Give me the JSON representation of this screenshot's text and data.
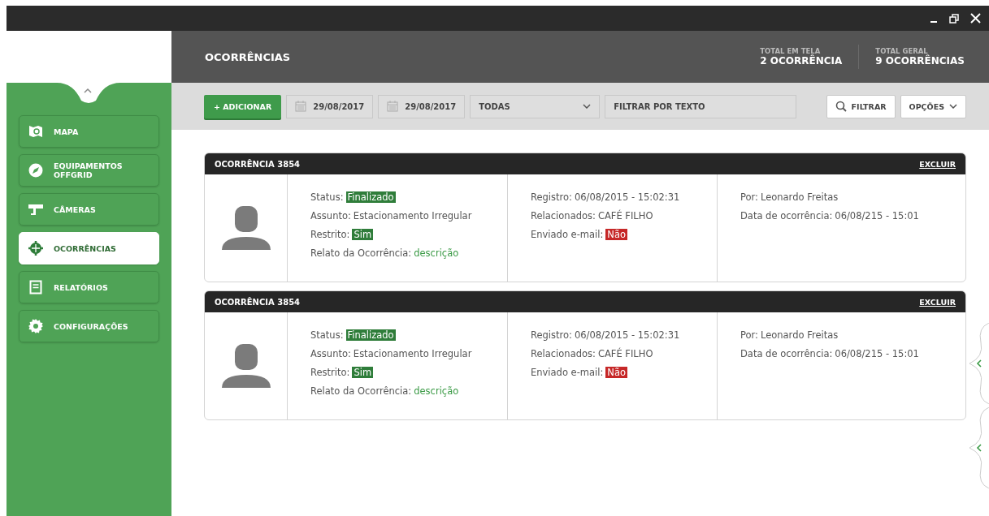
{
  "sidebar": {
    "items": [
      {
        "label": "MAPA",
        "selected": false
      },
      {
        "label": "EQUIPAMENTOS OFFGRID",
        "selected": false
      },
      {
        "label": "CÂMERAS",
        "selected": false
      },
      {
        "label": "OCORRÊNCIAS",
        "selected": true
      },
      {
        "label": "RELATÓRIOS",
        "selected": false
      },
      {
        "label": "CONFIGURAÇÕES",
        "selected": false
      }
    ]
  },
  "header": {
    "title": "OCORRÊNCIAS",
    "totals": [
      {
        "label": "TOTAL EM TELA",
        "value": "2 OCORRÊNCIA"
      },
      {
        "label": "TOTAL GERAL",
        "value": "9 OCORRÊNCIAS"
      }
    ]
  },
  "toolbar": {
    "add_button": "+ ADICIONAR",
    "dates": [
      "29/08/2017",
      "29/08/2017"
    ],
    "select": "TODAS",
    "search": {
      "placeholder": "FILTRAR POR TEXTO"
    },
    "filter_button": "FILTRAR",
    "options_button": "OPÇÕES"
  },
  "cards": [
    {
      "title": "OCORRÊNCIA 3854",
      "delete": "EXCLUIR",
      "columns": [
        [
          {
            "label": "Status:",
            "value": "Finalizado",
            "kind": "badge",
            "color": "#2f7d3a"
          },
          {
            "label": "Assunto:",
            "value": "Estacionamento Irregular",
            "kind": "plain"
          },
          {
            "label": "Restrito:",
            "value": "Sim",
            "kind": "badge",
            "color": "#2f7d3a"
          },
          {
            "label": "Relato da Ocorrência:",
            "value": "descrição",
            "kind": "link"
          }
        ],
        [
          {
            "label": "Registro:",
            "value": "06/08/2015 - 15:02:31",
            "kind": "plain"
          },
          {
            "label": "Relacionados:",
            "value": "CAFÉ FILHO",
            "kind": "plain"
          },
          {
            "label": "Enviado e-mail:",
            "value": "Não",
            "kind": "badge",
            "color": "#c62828"
          }
        ],
        [
          {
            "label": "Por:",
            "value": "Leonardo Freitas",
            "kind": "plain"
          },
          {
            "label": "Data de ocorrência:",
            "value": "06/08/215 - 15:01",
            "kind": "plain"
          }
        ]
      ]
    },
    {
      "title": "OCORRÊNCIA 3854",
      "delete": "EXCLUIR",
      "columns": [
        [
          {
            "label": "Status:",
            "value": "Finalizado",
            "kind": "badge",
            "color": "#2f7d3a"
          },
          {
            "label": "Assunto:",
            "value": "Estacionamento Irregular",
            "kind": "plain"
          },
          {
            "label": "Restrito:",
            "value": "Sim",
            "kind": "badge",
            "color": "#2f7d3a"
          },
          {
            "label": "Relato da Ocorrência:",
            "value": "descrição",
            "kind": "link"
          }
        ],
        [
          {
            "label": "Registro:",
            "value": "06/08/2015 - 15:02:31",
            "kind": "plain"
          },
          {
            "label": "Relacionados:",
            "value": "CAFÉ FILHO",
            "kind": "plain"
          },
          {
            "label": "Enviado e-mail:",
            "value": "Não",
            "kind": "badge",
            "color": "#c62828"
          }
        ],
        [
          {
            "label": "Por:",
            "value": "Leonardo Freitas",
            "kind": "plain"
          },
          {
            "label": "Data de ocorrência:",
            "value": "06/08/215 - 15:01",
            "kind": "plain"
          }
        ]
      ]
    }
  ]
}
